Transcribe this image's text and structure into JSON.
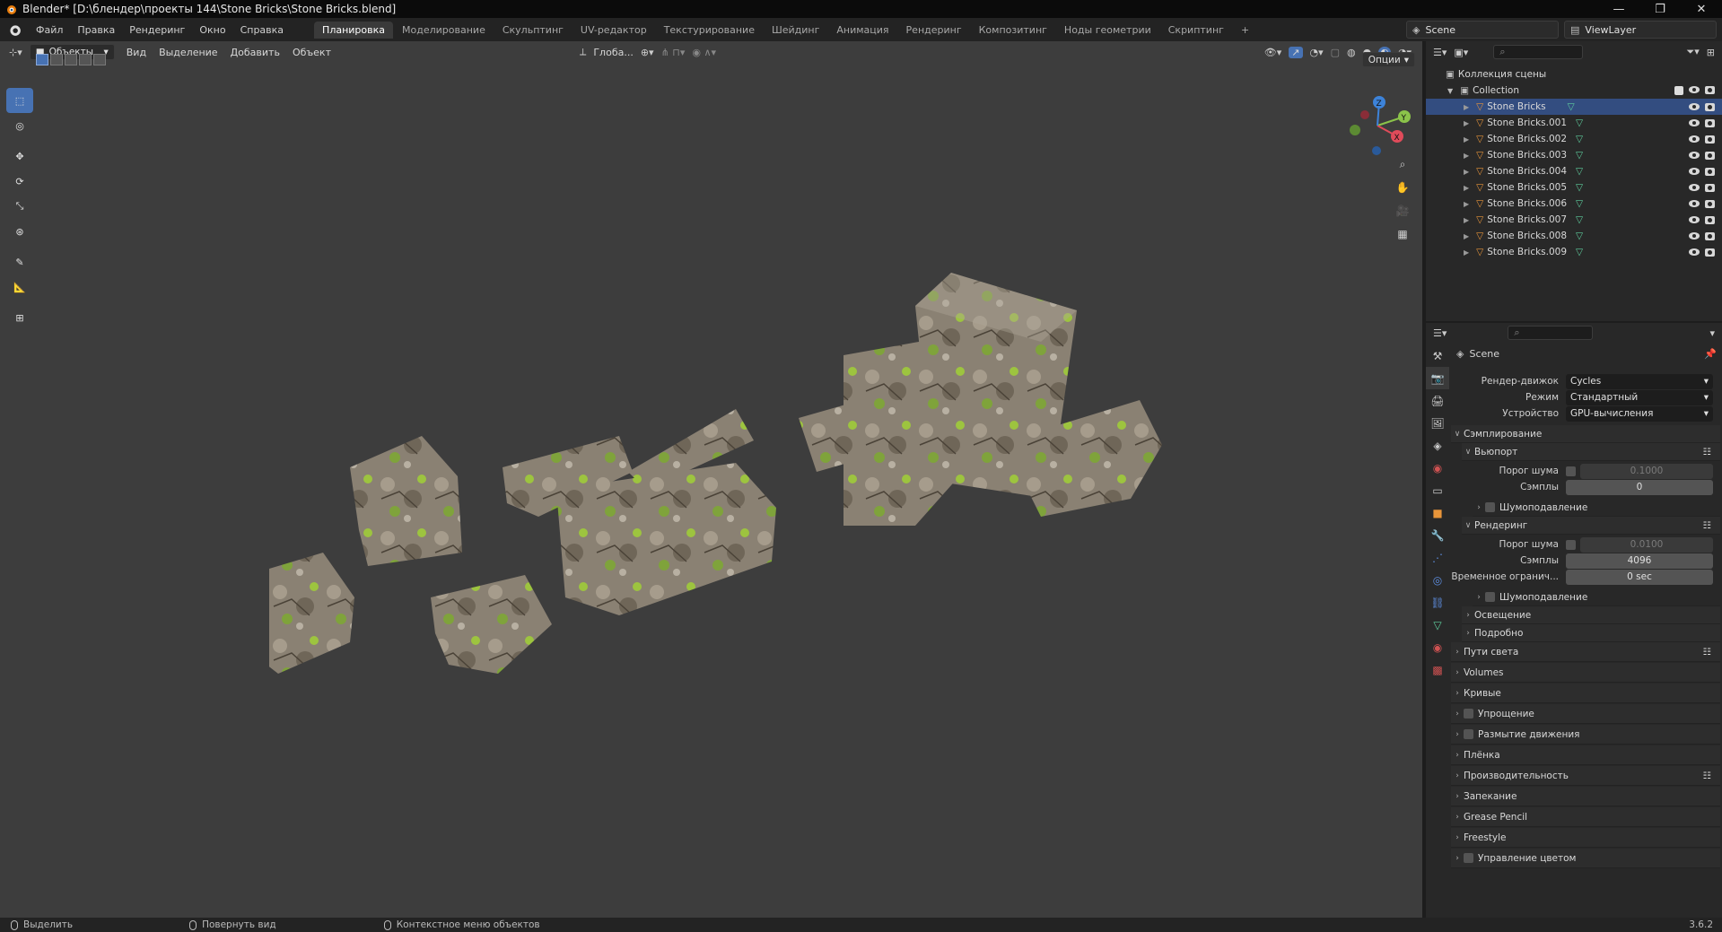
{
  "window": {
    "title": "Blender* [D:\\блендер\\проекты 144\\Stone Bricks\\Stone Bricks.blend]",
    "buttons": [
      "—",
      "❐",
      "✕"
    ]
  },
  "menubar": {
    "menus": [
      "Файл",
      "Правка",
      "Рендеринг",
      "Окно",
      "Справка"
    ],
    "workspaces": [
      "Планировка",
      "Моделирование",
      "Скульптинг",
      "UV-редактор",
      "Текстурирование",
      "Шейдинг",
      "Анимация",
      "Рендеринг",
      "Композитинг",
      "Ноды геометрии",
      "Скриптинг"
    ],
    "active_workspace": "Планировка",
    "add_tab": "+",
    "scene": "Scene",
    "view_layer": "ViewLayer"
  },
  "viewport": {
    "mode": "Объекты",
    "menus": [
      "Вид",
      "Выделение",
      "Добавить",
      "Объект"
    ],
    "orientation": "Глоба...",
    "options": "Опции",
    "axes": {
      "x": "X",
      "y": "Y",
      "z": "Z"
    },
    "background": "#3d3d3d"
  },
  "outliner": {
    "scene_collection": "Коллекция сцены",
    "collection": "Collection",
    "objects": [
      "Stone Bricks",
      "Stone Bricks.001",
      "Stone Bricks.002",
      "Stone Bricks.003",
      "Stone Bricks.004",
      "Stone Bricks.005",
      "Stone Bricks.006",
      "Stone Bricks.007",
      "Stone Bricks.008",
      "Stone Bricks.009"
    ],
    "selected": "Stone Bricks"
  },
  "properties": {
    "scene": "Scene",
    "render_engine_label": "Рендер-движок",
    "render_engine": "Cycles",
    "mode_label": "Режим",
    "mode": "Стандартный",
    "device_label": "Устройство",
    "device": "GPU-вычисления",
    "sampling": "Сэмплирование",
    "viewport": "Вьюпорт",
    "noise_threshold_label": "Порог шума",
    "viewport_noise_threshold": "0.1000",
    "samples_label": "Сэмплы",
    "viewport_samples": "0",
    "denoise": "Шумоподавление",
    "render": "Рендеринг",
    "render_noise_threshold": "0.0100",
    "render_samples": "4096",
    "time_limit_label": "Временное огранич...",
    "time_limit": "0 sec",
    "render_denoise": "Шумоподавление",
    "lights": "Освещение",
    "advanced": "Подробно",
    "panels": [
      "Пути света",
      "Volumes",
      "Кривые",
      "Упрощение",
      "Размытие движения",
      "Плёнка",
      "Производительность",
      "Запекание",
      "Grease Pencil",
      "Freestyle",
      "Управление цветом"
    ]
  },
  "statusbar": {
    "select": "Выделить",
    "rotate": "Повернуть вид",
    "context_menu": "Контекстное меню объектов",
    "version": "3.6.2"
  },
  "colors": {
    "accent": "#4772b3",
    "selected_row": "#334d80",
    "mesh_orange": "#e8953a",
    "mesh_green": "#5fce9e"
  }
}
